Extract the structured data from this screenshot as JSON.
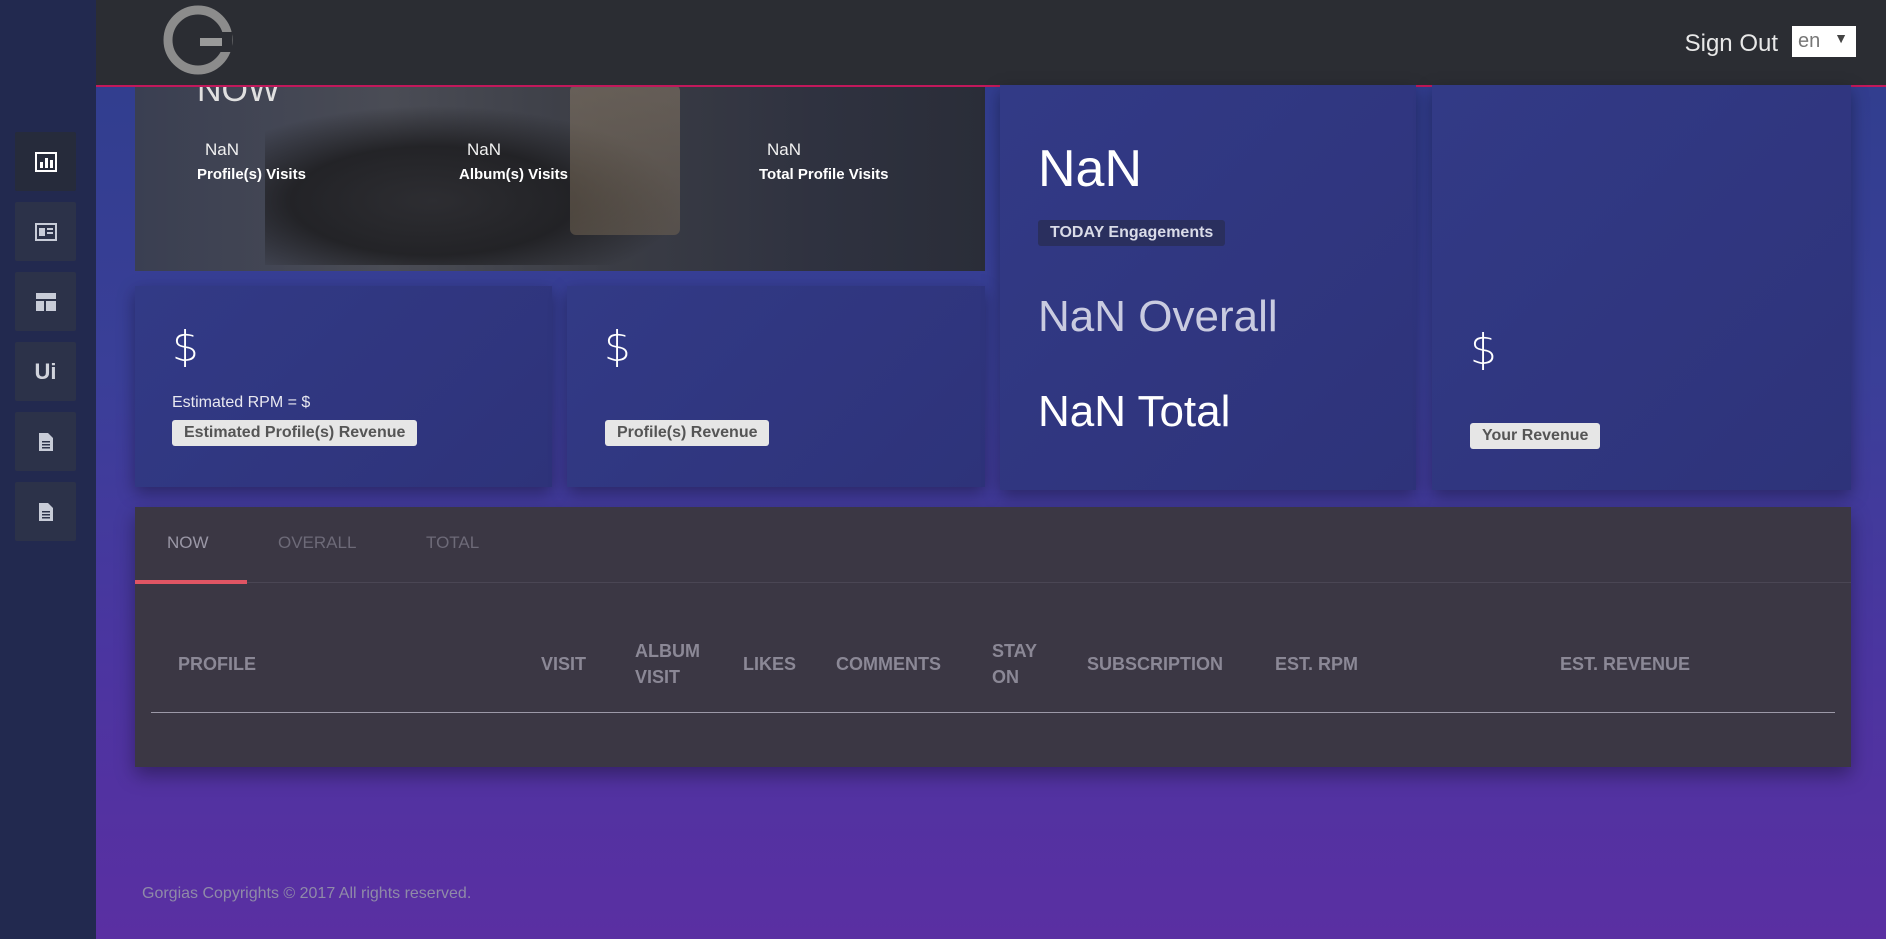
{
  "header": {
    "sign_out": "Sign Out",
    "language": "en"
  },
  "sidebar": {
    "items": [
      {
        "icon": "bar-chart-icon"
      },
      {
        "icon": "news-icon"
      },
      {
        "icon": "layout-icon"
      },
      {
        "label": "Ui"
      },
      {
        "icon": "document-icon"
      },
      {
        "icon": "document-icon"
      }
    ]
  },
  "hero": {
    "title": "NOW",
    "stats": [
      {
        "value": "NaN",
        "label": "Profile(s) Visits"
      },
      {
        "value": "NaN",
        "label": "Album(s) Visits"
      },
      {
        "value": "NaN",
        "label": "Total Profile Visits"
      }
    ]
  },
  "cards": {
    "estimated": {
      "amount": "$",
      "rpm": "Estimated RPM = $",
      "label": "Estimated Profile(s) Revenue"
    },
    "profile_revenue": {
      "amount": "$",
      "label": "Profile(s) Revenue"
    },
    "engagements": {
      "today": "NaN",
      "label": "TODAY Engagements",
      "overall": "NaN Overall",
      "total": "NaN Total"
    },
    "your_revenue": {
      "amount": "$",
      "label": "Your Revenue"
    }
  },
  "table": {
    "tabs": [
      "NOW",
      "OVERALL",
      "TOTAL"
    ],
    "columns": [
      "PROFILE",
      "VISIT",
      "ALBUM VISIT",
      "LIKES",
      "COMMENTS",
      "STAY ON",
      "SUBSCRIPTION",
      "EST. RPM",
      "EST. REVENUE"
    ]
  },
  "footer": {
    "copyright": "Gorgias Copyrights © 2017 All rights reserved."
  },
  "colors": {
    "accent": "#c2185b",
    "tab_underline": "#e05564"
  }
}
